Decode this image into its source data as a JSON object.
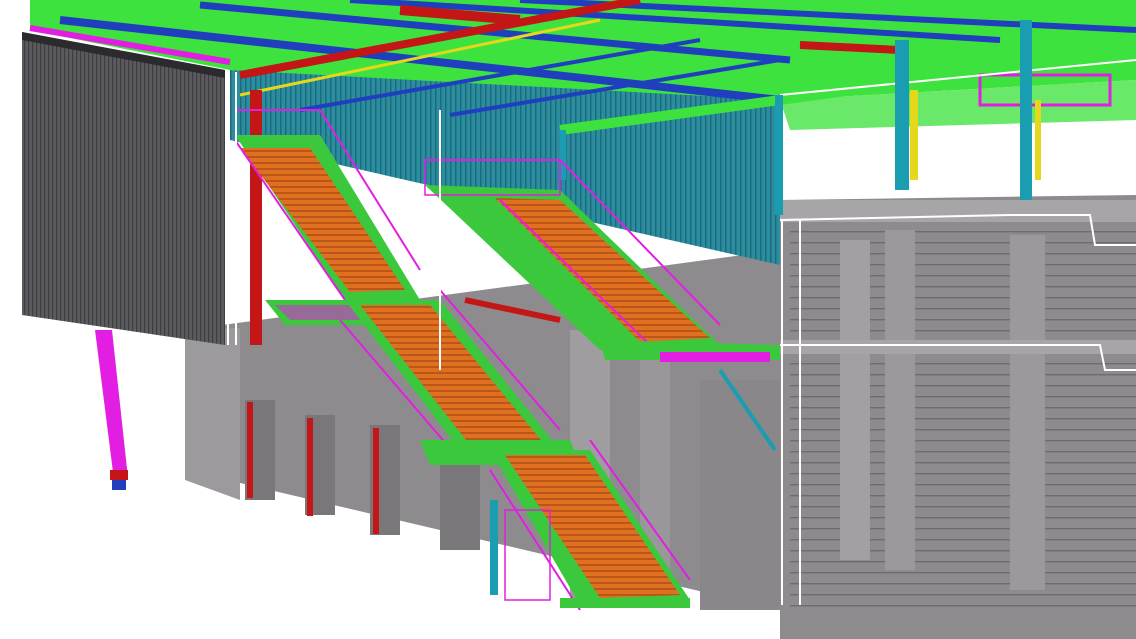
{
  "scene": {
    "kind": "3d-structural-steel-model",
    "background": "#ffffff",
    "colors": {
      "roof_green": "#3ee23e",
      "beam_blue": "#1f3fbf",
      "beam_red": "#c41616",
      "brace_magenta": "#e21ee2",
      "column_cyan": "#1a9db0",
      "column_yellow": "#e5d81a",
      "stair_orange": "#e07020",
      "stringer_green": "#3cc83c",
      "cladding_teal": "#2a8ea0",
      "cladding_grey": "#5a5a5f",
      "concrete_grey": "#8e8b8e",
      "concrete_light": "#a8a5a8",
      "outline_white": "#ffffff"
    },
    "visible_text": []
  }
}
